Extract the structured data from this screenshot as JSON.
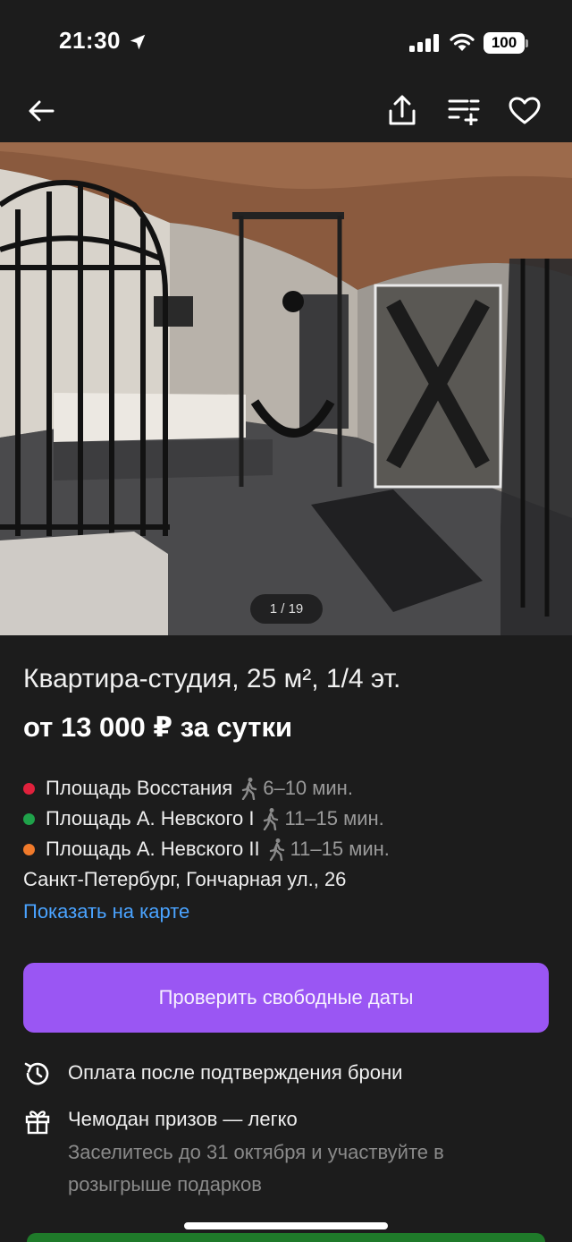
{
  "status_bar": {
    "time": "21:30",
    "battery": "100"
  },
  "nav": {
    "back_icon": "arrow-left-icon",
    "share_icon": "share-icon",
    "compare_icon": "compare-list-icon",
    "favorite_icon": "heart-icon"
  },
  "photo": {
    "counter": "1 / 19"
  },
  "listing": {
    "title": "Квартира-студия, 25 м², 1/4 эт.",
    "price": "от 13 000 ₽ за сутки"
  },
  "metro": [
    {
      "station": "Площадь Восстания",
      "time": "6–10 мин.",
      "color": "#e0213c"
    },
    {
      "station": "Площадь А. Невского I",
      "time": "11–15 мин.",
      "color": "#1fa24a"
    },
    {
      "station": "Площадь А. Невского II",
      "time": "11–15 мин.",
      "color": "#f07a2b"
    }
  ],
  "address": "Санкт-Петербург, Гончарная ул., 26",
  "map_link": "Показать на карте",
  "cta_label": "Проверить свободные даты",
  "features": {
    "payment": {
      "text": "Оплата после подтверждения брони",
      "icon": "history-icon"
    },
    "prize": {
      "text": "Чемодан призов — легко",
      "sub": "Заселитесь до 31 октября и участвуйте в розыгрыше подарков",
      "icon": "gift-icon"
    }
  },
  "colors": {
    "background": "#1c1c1c",
    "accent": "#9a56f3",
    "link": "#4aa3ff"
  }
}
